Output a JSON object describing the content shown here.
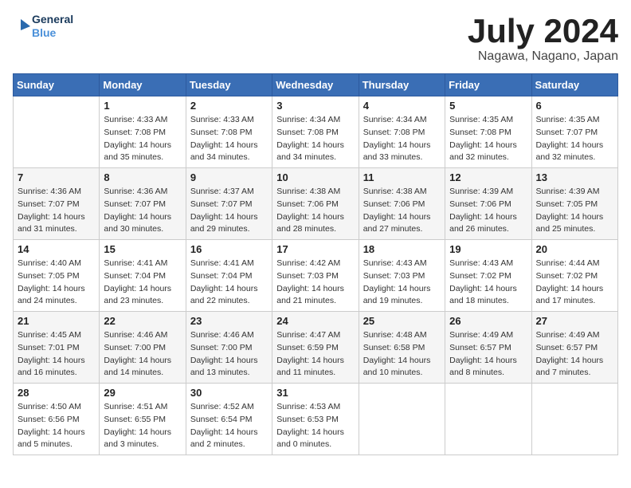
{
  "header": {
    "logo_line1": "General",
    "logo_line2": "Blue",
    "month_year": "July 2024",
    "location": "Nagawa, Nagano, Japan"
  },
  "days_of_week": [
    "Sunday",
    "Monday",
    "Tuesday",
    "Wednesday",
    "Thursday",
    "Friday",
    "Saturday"
  ],
  "weeks": [
    [
      {
        "day": "",
        "sunrise": "",
        "sunset": "",
        "daylight": ""
      },
      {
        "day": "1",
        "sunrise": "Sunrise: 4:33 AM",
        "sunset": "Sunset: 7:08 PM",
        "daylight": "Daylight: 14 hours and 35 minutes."
      },
      {
        "day": "2",
        "sunrise": "Sunrise: 4:33 AM",
        "sunset": "Sunset: 7:08 PM",
        "daylight": "Daylight: 14 hours and 34 minutes."
      },
      {
        "day": "3",
        "sunrise": "Sunrise: 4:34 AM",
        "sunset": "Sunset: 7:08 PM",
        "daylight": "Daylight: 14 hours and 34 minutes."
      },
      {
        "day": "4",
        "sunrise": "Sunrise: 4:34 AM",
        "sunset": "Sunset: 7:08 PM",
        "daylight": "Daylight: 14 hours and 33 minutes."
      },
      {
        "day": "5",
        "sunrise": "Sunrise: 4:35 AM",
        "sunset": "Sunset: 7:08 PM",
        "daylight": "Daylight: 14 hours and 32 minutes."
      },
      {
        "day": "6",
        "sunrise": "Sunrise: 4:35 AM",
        "sunset": "Sunset: 7:07 PM",
        "daylight": "Daylight: 14 hours and 32 minutes."
      }
    ],
    [
      {
        "day": "7",
        "sunrise": "Sunrise: 4:36 AM",
        "sunset": "Sunset: 7:07 PM",
        "daylight": "Daylight: 14 hours and 31 minutes."
      },
      {
        "day": "8",
        "sunrise": "Sunrise: 4:36 AM",
        "sunset": "Sunset: 7:07 PM",
        "daylight": "Daylight: 14 hours and 30 minutes."
      },
      {
        "day": "9",
        "sunrise": "Sunrise: 4:37 AM",
        "sunset": "Sunset: 7:07 PM",
        "daylight": "Daylight: 14 hours and 29 minutes."
      },
      {
        "day": "10",
        "sunrise": "Sunrise: 4:38 AM",
        "sunset": "Sunset: 7:06 PM",
        "daylight": "Daylight: 14 hours and 28 minutes."
      },
      {
        "day": "11",
        "sunrise": "Sunrise: 4:38 AM",
        "sunset": "Sunset: 7:06 PM",
        "daylight": "Daylight: 14 hours and 27 minutes."
      },
      {
        "day": "12",
        "sunrise": "Sunrise: 4:39 AM",
        "sunset": "Sunset: 7:06 PM",
        "daylight": "Daylight: 14 hours and 26 minutes."
      },
      {
        "day": "13",
        "sunrise": "Sunrise: 4:39 AM",
        "sunset": "Sunset: 7:05 PM",
        "daylight": "Daylight: 14 hours and 25 minutes."
      }
    ],
    [
      {
        "day": "14",
        "sunrise": "Sunrise: 4:40 AM",
        "sunset": "Sunset: 7:05 PM",
        "daylight": "Daylight: 14 hours and 24 minutes."
      },
      {
        "day": "15",
        "sunrise": "Sunrise: 4:41 AM",
        "sunset": "Sunset: 7:04 PM",
        "daylight": "Daylight: 14 hours and 23 minutes."
      },
      {
        "day": "16",
        "sunrise": "Sunrise: 4:41 AM",
        "sunset": "Sunset: 7:04 PM",
        "daylight": "Daylight: 14 hours and 22 minutes."
      },
      {
        "day": "17",
        "sunrise": "Sunrise: 4:42 AM",
        "sunset": "Sunset: 7:03 PM",
        "daylight": "Daylight: 14 hours and 21 minutes."
      },
      {
        "day": "18",
        "sunrise": "Sunrise: 4:43 AM",
        "sunset": "Sunset: 7:03 PM",
        "daylight": "Daylight: 14 hours and 19 minutes."
      },
      {
        "day": "19",
        "sunrise": "Sunrise: 4:43 AM",
        "sunset": "Sunset: 7:02 PM",
        "daylight": "Daylight: 14 hours and 18 minutes."
      },
      {
        "day": "20",
        "sunrise": "Sunrise: 4:44 AM",
        "sunset": "Sunset: 7:02 PM",
        "daylight": "Daylight: 14 hours and 17 minutes."
      }
    ],
    [
      {
        "day": "21",
        "sunrise": "Sunrise: 4:45 AM",
        "sunset": "Sunset: 7:01 PM",
        "daylight": "Daylight: 14 hours and 16 minutes."
      },
      {
        "day": "22",
        "sunrise": "Sunrise: 4:46 AM",
        "sunset": "Sunset: 7:00 PM",
        "daylight": "Daylight: 14 hours and 14 minutes."
      },
      {
        "day": "23",
        "sunrise": "Sunrise: 4:46 AM",
        "sunset": "Sunset: 7:00 PM",
        "daylight": "Daylight: 14 hours and 13 minutes."
      },
      {
        "day": "24",
        "sunrise": "Sunrise: 4:47 AM",
        "sunset": "Sunset: 6:59 PM",
        "daylight": "Daylight: 14 hours and 11 minutes."
      },
      {
        "day": "25",
        "sunrise": "Sunrise: 4:48 AM",
        "sunset": "Sunset: 6:58 PM",
        "daylight": "Daylight: 14 hours and 10 minutes."
      },
      {
        "day": "26",
        "sunrise": "Sunrise: 4:49 AM",
        "sunset": "Sunset: 6:57 PM",
        "daylight": "Daylight: 14 hours and 8 minutes."
      },
      {
        "day": "27",
        "sunrise": "Sunrise: 4:49 AM",
        "sunset": "Sunset: 6:57 PM",
        "daylight": "Daylight: 14 hours and 7 minutes."
      }
    ],
    [
      {
        "day": "28",
        "sunrise": "Sunrise: 4:50 AM",
        "sunset": "Sunset: 6:56 PM",
        "daylight": "Daylight: 14 hours and 5 minutes."
      },
      {
        "day": "29",
        "sunrise": "Sunrise: 4:51 AM",
        "sunset": "Sunset: 6:55 PM",
        "daylight": "Daylight: 14 hours and 3 minutes."
      },
      {
        "day": "30",
        "sunrise": "Sunrise: 4:52 AM",
        "sunset": "Sunset: 6:54 PM",
        "daylight": "Daylight: 14 hours and 2 minutes."
      },
      {
        "day": "31",
        "sunrise": "Sunrise: 4:53 AM",
        "sunset": "Sunset: 6:53 PM",
        "daylight": "Daylight: 14 hours and 0 minutes."
      },
      {
        "day": "",
        "sunrise": "",
        "sunset": "",
        "daylight": ""
      },
      {
        "day": "",
        "sunrise": "",
        "sunset": "",
        "daylight": ""
      },
      {
        "day": "",
        "sunrise": "",
        "sunset": "",
        "daylight": ""
      }
    ]
  ]
}
